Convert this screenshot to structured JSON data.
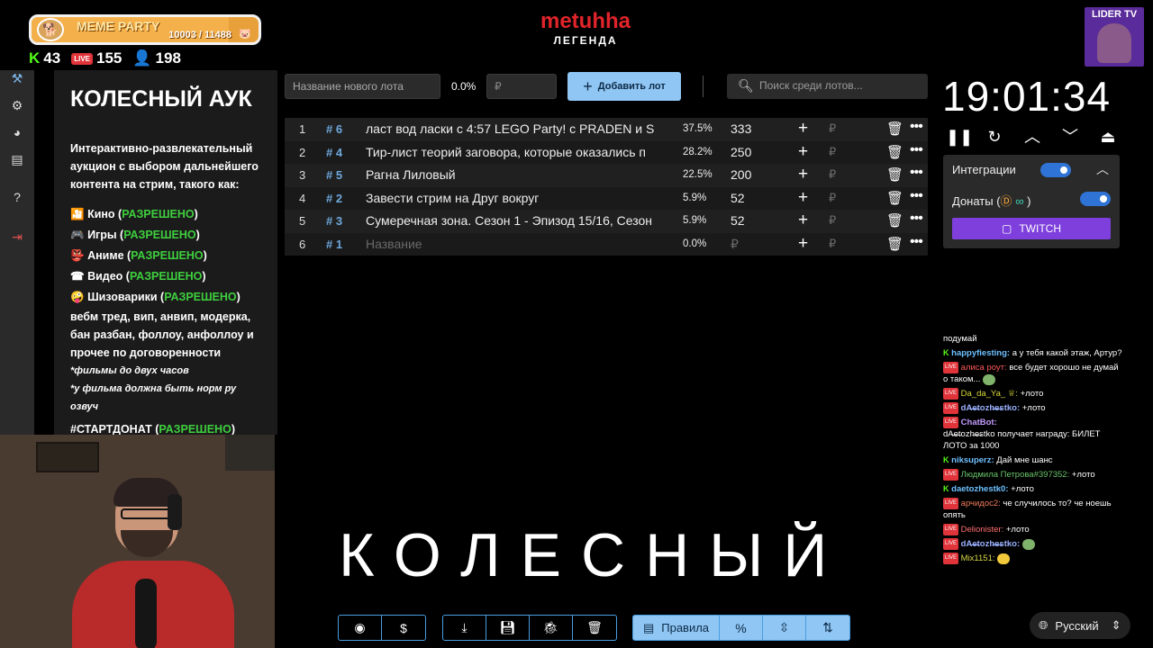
{
  "overlay": {
    "meme_party": {
      "title": "MEME PARTY",
      "current": "10003",
      "goal": "11488",
      "progress": 0.87
    },
    "stats": {
      "kick_viewers": "43",
      "live_viewers": "155",
      "followers": "198"
    },
    "brand": {
      "name": "metuhha",
      "subtitle": "ЛЕГЕНДА"
    },
    "leader_badge": "LIDER TV"
  },
  "info_panel": {
    "title": "КОЛЕСНЫЙ АУК",
    "description": "Интерактивно-развлекательный аукцион с выбором дальнейшего контента на стрим, такого как:",
    "categories": [
      {
        "icon": "🎦",
        "label": "Кино",
        "status": "РАЗРЕШЕНО"
      },
      {
        "icon": "🎮",
        "label": "Игры",
        "status": "РАЗРЕШЕНО"
      },
      {
        "icon": "👺",
        "label": "Аниме",
        "status": "РАЗРЕШЕНО"
      },
      {
        "icon": "☎",
        "label": "Видео",
        "status": "РАЗРЕШЕНО"
      },
      {
        "icon": "🤪",
        "label": "Шизоварики",
        "status": "РАЗРЕШЕНО"
      }
    ],
    "extra": "вебм тред, вип, анвип, модерка, бан разбан, фоллоу, анфоллоу и прочее по договоренности",
    "note1": "*фильмы до двух часов",
    "note2": "*у фильма должна быть норм ру озвуч",
    "footer_label": "#СТАРТДОНАТ",
    "footer_status": "РАЗРЕШЕНО"
  },
  "toolbar": {
    "lot_name_placeholder": "Название нового лота",
    "percent": "0.0%",
    "amount_placeholder": "₽",
    "add_button": "Добавить лот",
    "search_placeholder": "Поиск среди лотов..."
  },
  "lots": [
    {
      "index": "1",
      "id": "# 6",
      "name": "ласт вод ласки с 4:57 LEGO Party! с PRADEN и S",
      "percent": "37.5%",
      "amount": "333"
    },
    {
      "index": "2",
      "id": "# 4",
      "name": "Тир-лист теорий заговора, которые оказались п",
      "percent": "28.2%",
      "amount": "250"
    },
    {
      "index": "3",
      "id": "# 5",
      "name": "Рагна Лиловый",
      "percent": "22.5%",
      "amount": "200"
    },
    {
      "index": "4",
      "id": "# 2",
      "name": "Завести стрим на Друг вокруг",
      "percent": "5.9%",
      "amount": "52"
    },
    {
      "index": "5",
      "id": "# 3",
      "name": "Сумеречная зона. Сезон 1 - Эпизод 15/16, Сезон",
      "percent": "5.9%",
      "amount": "52"
    },
    {
      "index": "6",
      "id": "# 1",
      "name_placeholder": "Название",
      "percent": "0.0%",
      "amount_placeholder": "₽"
    }
  ],
  "currency": "₽",
  "big_word": "КОЛЕСНЫЙ",
  "timer": "19:01:34",
  "integrations": {
    "title": "Интеграции",
    "donations_label": "Донаты (",
    "donations_suffix": ")",
    "twitch_button": "TWITCH"
  },
  "bottom_bar": {
    "rules_label": "Правила",
    "language": "Русский"
  },
  "chat": [
    {
      "platform": "",
      "user": "",
      "text": "подумай"
    },
    {
      "platform": "kick",
      "user": "happyfiesting:",
      "text": "а у тебя какой этаж, Артур?"
    },
    {
      "platform": "live",
      "user": "алиса роут:",
      "text": "все будет хорошо не думай о таком..."
    },
    {
      "platform": "live",
      "user": "Da_da_Ya_ ♕:",
      "text": "+лото"
    },
    {
      "platform": "live",
      "user": "dA̶e̶tozh̶e̶stko:",
      "text": "+лото"
    },
    {
      "platform": "live",
      "user": "ChatBot:",
      "text": "dA̶e̶tozh̶e̶stko получает награду: БИЛЕТ ЛОТО за 1000"
    },
    {
      "platform": "kick",
      "user": "niksuperz:",
      "text": "Дай мне шанс"
    },
    {
      "platform": "live",
      "user": "Людмила Петрова#397352:",
      "text": "+лото"
    },
    {
      "platform": "kick",
      "user": "daetozhestk0:",
      "text": "+лото"
    },
    {
      "platform": "live",
      "user": "арчидос2:",
      "text": "че случилось то? че ноешь опять"
    },
    {
      "platform": "live",
      "user": "Delionister:",
      "text": "+лото"
    },
    {
      "platform": "live",
      "user": "dA̶e̶tozh̶e̶stko:",
      "text": ""
    },
    {
      "platform": "live",
      "user": "Mix1151:",
      "text": ""
    }
  ]
}
